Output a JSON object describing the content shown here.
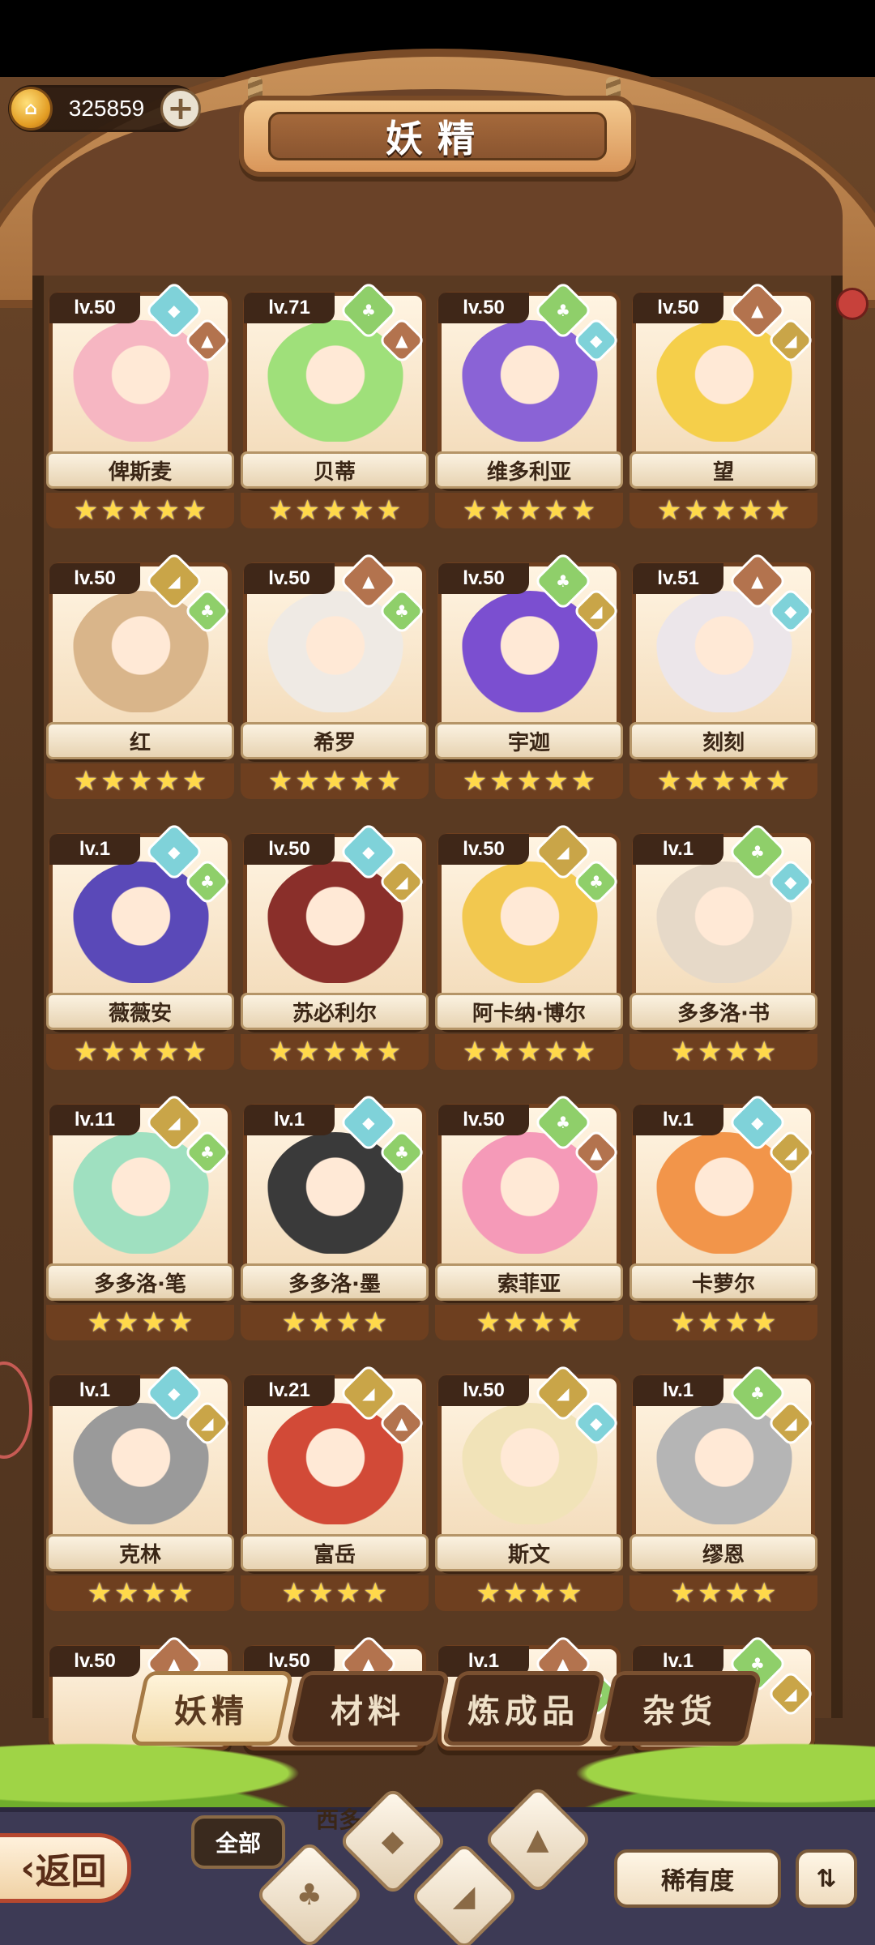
{
  "currency": {
    "value": "325859",
    "coin_glyph": "⌂",
    "add_glyph": "+"
  },
  "title": "妖精",
  "tabs": [
    "妖精",
    "材料",
    "炼成品",
    "杂货"
  ],
  "filters": {
    "all": "全部",
    "rarity": "稀有度",
    "sort_glyph": "⇅",
    "back": "返回",
    "back_glyph": "‹",
    "peek_name": "西多"
  },
  "colors": {
    "water": "#7fd2d9",
    "leaf": "#8fcf6a",
    "earth": "#c9a548",
    "mountain": "#b3734e",
    "wood": "#6e3f1f"
  },
  "elements": {
    "water": {
      "color": "#7fd2d9",
      "glyph": "◆"
    },
    "leaf": {
      "color": "#8fcf6a",
      "glyph": "♣"
    },
    "earth": {
      "color": "#c9a548",
      "glyph": "◢"
    },
    "mountain": {
      "color": "#b3734e",
      "glyph": "▲"
    }
  },
  "fairies": [
    {
      "level": "lv.50",
      "name": "俾斯麦",
      "stars": 5,
      "elements": [
        "water",
        "mountain"
      ],
      "tint": "#f6b6c2"
    },
    {
      "level": "lv.71",
      "name": "贝蒂",
      "stars": 5,
      "elements": [
        "leaf",
        "mountain"
      ],
      "tint": "#9fe07a"
    },
    {
      "level": "lv.50",
      "name": "维多利亚",
      "stars": 5,
      "elements": [
        "leaf",
        "water"
      ],
      "tint": "#8a63d6"
    },
    {
      "level": "lv.50",
      "name": "望",
      "stars": 5,
      "elements": [
        "mountain",
        "earth"
      ],
      "tint": "#f5cf4a"
    },
    {
      "level": "lv.50",
      "name": "红",
      "stars": 5,
      "elements": [
        "earth",
        "leaf"
      ],
      "tint": "#d9b58a"
    },
    {
      "level": "lv.50",
      "name": "希罗",
      "stars": 5,
      "elements": [
        "mountain",
        "leaf"
      ],
      "tint": "#efeae4"
    },
    {
      "level": "lv.50",
      "name": "宇迦",
      "stars": 5,
      "elements": [
        "leaf",
        "earth"
      ],
      "tint": "#7b4fd0"
    },
    {
      "level": "lv.51",
      "name": "刻刻",
      "stars": 5,
      "elements": [
        "mountain",
        "water"
      ],
      "tint": "#ece6ea"
    },
    {
      "level": "lv.1",
      "name": "薇薇安",
      "stars": 5,
      "elements": [
        "water",
        "leaf"
      ],
      "tint": "#5a49b8"
    },
    {
      "level": "lv.50",
      "name": "苏必利尔",
      "stars": 5,
      "elements": [
        "water",
        "earth"
      ],
      "tint": "#8a2f2a"
    },
    {
      "level": "lv.50",
      "name": "阿卡纳·博尔",
      "stars": 5,
      "elements": [
        "earth",
        "leaf"
      ],
      "tint": "#f2c84f"
    },
    {
      "level": "lv.1",
      "name": "多多洛·书",
      "stars": 4,
      "elements": [
        "leaf",
        "water"
      ],
      "tint": "#e6d9c8"
    },
    {
      "level": "lv.11",
      "name": "多多洛·笔",
      "stars": 4,
      "elements": [
        "earth",
        "leaf"
      ],
      "tint": "#9fe0c0"
    },
    {
      "level": "lv.1",
      "name": "多多洛·墨",
      "stars": 4,
      "elements": [
        "water",
        "leaf"
      ],
      "tint": "#3a3a3a"
    },
    {
      "level": "lv.50",
      "name": "索菲亚",
      "stars": 4,
      "elements": [
        "leaf",
        "mountain"
      ],
      "tint": "#f59ab8"
    },
    {
      "level": "lv.1",
      "name": "卡萝尔",
      "stars": 4,
      "elements": [
        "water",
        "earth"
      ],
      "tint": "#f2954a"
    },
    {
      "level": "lv.1",
      "name": "克林",
      "stars": 4,
      "elements": [
        "water",
        "earth"
      ],
      "tint": "#9a9a9a"
    },
    {
      "level": "lv.21",
      "name": "富岳",
      "stars": 4,
      "elements": [
        "earth",
        "mountain"
      ],
      "tint": "#d24a37"
    },
    {
      "level": "lv.50",
      "name": "斯文",
      "stars": 4,
      "elements": [
        "earth",
        "water"
      ],
      "tint": "#f1e3b8"
    },
    {
      "level": "lv.1",
      "name": "缪恩",
      "stars": 4,
      "elements": [
        "leaf",
        "earth"
      ],
      "tint": "#b5b5b5"
    }
  ],
  "partial_row": [
    {
      "level": "lv.50",
      "elements": [
        "mountain",
        "water"
      ]
    },
    {
      "level": "lv.50",
      "elements": [
        "mountain",
        "leaf"
      ]
    },
    {
      "level": "lv.1",
      "elements": [
        "mountain",
        "leaf"
      ]
    },
    {
      "level": "lv.1",
      "elements": [
        "leaf",
        "earth"
      ]
    }
  ]
}
